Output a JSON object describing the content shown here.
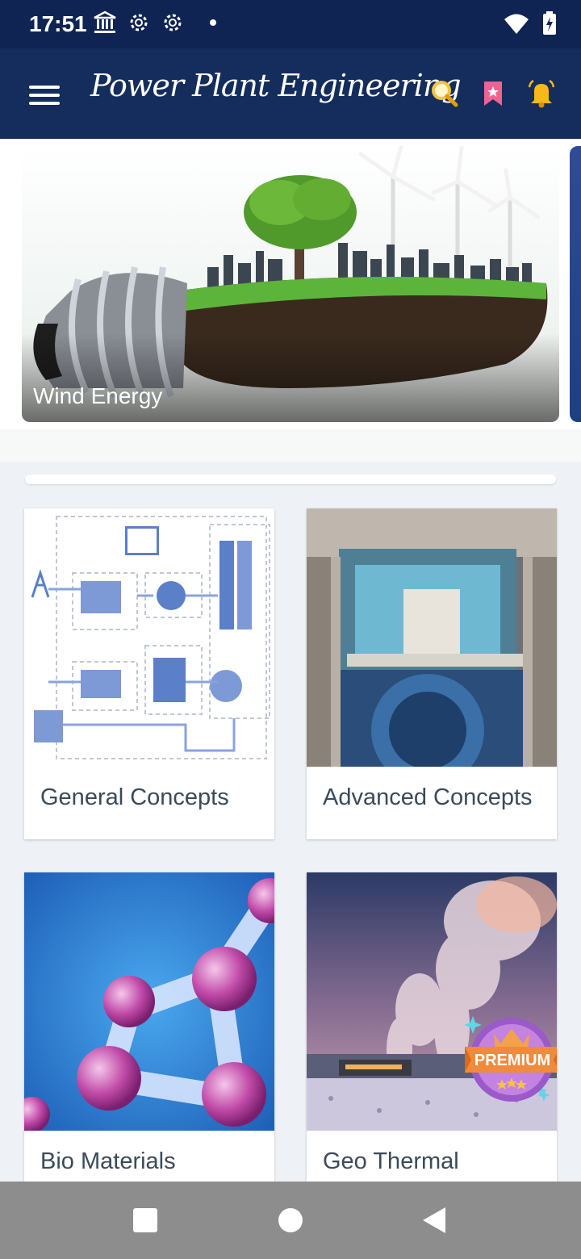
{
  "status_bar": {
    "time": "17:51",
    "left_icons": [
      "bank-icon",
      "gear-icon",
      "gear-icon",
      "dot-icon"
    ],
    "right_icons": [
      "wifi-icon",
      "battery-charging-icon"
    ]
  },
  "app_bar": {
    "title": "Power Plant Engineering",
    "actions": [
      "search-icon",
      "bookmark-icon",
      "notification-bell-icon"
    ],
    "colors": {
      "status": "#0f2453",
      "bar": "#142d5c",
      "icon_accent": "#f6c343",
      "bookmark": "#f06292"
    }
  },
  "carousel": {
    "banners": [
      {
        "title": "Wind Energy"
      }
    ]
  },
  "categories": [
    {
      "label": "General Concepts",
      "premium": false
    },
    {
      "label": "Advanced Concepts",
      "premium": false
    },
    {
      "label": "Bio Materials",
      "premium": false
    },
    {
      "label": "Geo Thermal",
      "premium": true,
      "badge": "PREMIUM"
    }
  ],
  "nav_bar": {
    "buttons": [
      "recents-square-icon",
      "home-circle-icon",
      "back-triangle-icon"
    ]
  }
}
